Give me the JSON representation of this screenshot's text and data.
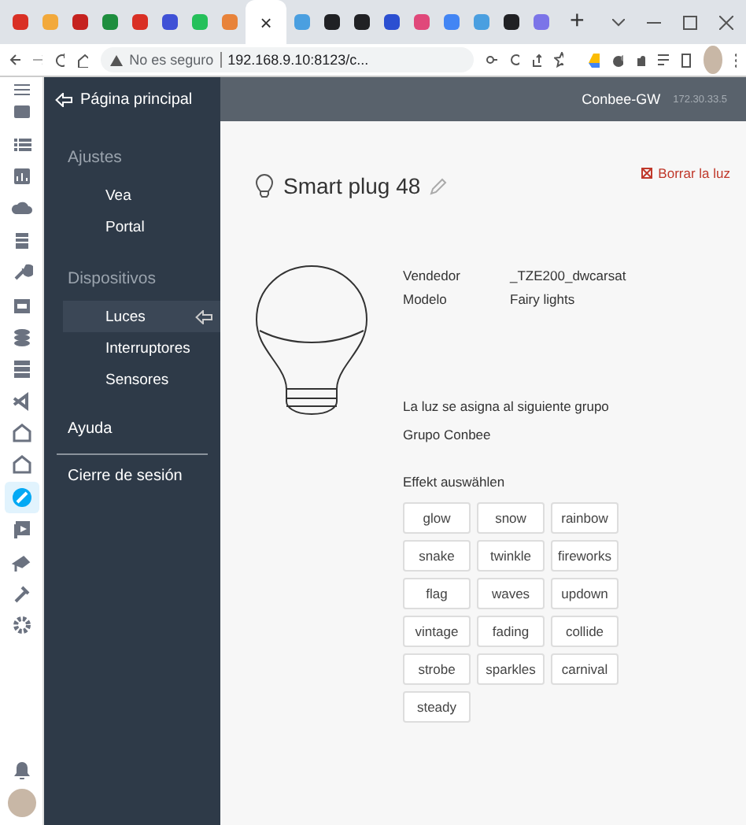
{
  "browser": {
    "tabs": [
      {
        "selected": false,
        "color": "#d93025"
      },
      {
        "selected": false,
        "color": "#f2a93b"
      },
      {
        "selected": false,
        "color": "#c5221f"
      },
      {
        "selected": false,
        "color": "#1e8e3e"
      },
      {
        "selected": false,
        "color": "#d93025"
      },
      {
        "selected": false,
        "color": "#3f51d6"
      },
      {
        "selected": false,
        "color": "#25c05a"
      },
      {
        "selected": false,
        "color": "#e8833a"
      },
      {
        "selected": true
      },
      {
        "selected": false,
        "color": "#4a9fe0"
      },
      {
        "selected": false,
        "color": "#202124"
      },
      {
        "selected": false,
        "color": "#202124"
      },
      {
        "selected": false,
        "color": "#2b4fd1"
      },
      {
        "selected": false,
        "color": "#e0487a"
      },
      {
        "selected": false,
        "color": "#4285f4"
      },
      {
        "selected": false,
        "color": "#4a9fe0"
      },
      {
        "selected": false,
        "color": "#202124"
      },
      {
        "selected": false,
        "color": "#7b74e8"
      }
    ],
    "close_tab": "×",
    "new_tab": "+",
    "security": "No es seguro",
    "url": "192.168.9.10:8123/c..."
  },
  "ha_sidebar": {
    "items": [
      {
        "selected": false
      },
      {
        "selected": false
      },
      {
        "selected": false
      },
      {
        "selected": false
      },
      {
        "selected": false
      },
      {
        "selected": false
      },
      {
        "selected": false
      },
      {
        "selected": false
      },
      {
        "selected": false
      },
      {
        "selected": false
      },
      {
        "selected": false
      },
      {
        "selected": false
      },
      {
        "selected": true
      },
      {
        "selected": false
      },
      {
        "selected": false
      },
      {
        "selected": false
      },
      {
        "selected": false
      }
    ]
  },
  "nav": {
    "home": "Página principal",
    "sections": [
      {
        "title": "Ajustes",
        "items": [
          {
            "label": "Vea",
            "selected": false
          },
          {
            "label": "Portal",
            "selected": false
          }
        ]
      },
      {
        "title": "Dispositivos",
        "items": [
          {
            "label": "Luces",
            "selected": true
          },
          {
            "label": "Interruptores",
            "selected": false
          },
          {
            "label": "Sensores",
            "selected": false
          }
        ]
      }
    ],
    "help": "Ayuda",
    "logout": "Cierre de sesión"
  },
  "topbar": {
    "gateway": "Conbee-GW",
    "ip": "172.30.33.5"
  },
  "device": {
    "name": "Smart plug 48",
    "delete": "Borrar la luz",
    "properties": [
      {
        "label": "Vendedor",
        "value": "_TZE200_dwcarsat"
      },
      {
        "label": "Modelo",
        "value": "Fairy lights"
      }
    ],
    "group_note": "La luz se asigna al siguiente grupo",
    "group": "Grupo Conbee",
    "effects_title": "Effekt auswählen",
    "effects": [
      "glow",
      "snow",
      "rainbow",
      "snake",
      "twinkle",
      "fireworks",
      "flag",
      "waves",
      "updown",
      "vintage",
      "fading",
      "collide",
      "strobe",
      "sparkles",
      "carnival",
      "steady"
    ]
  }
}
